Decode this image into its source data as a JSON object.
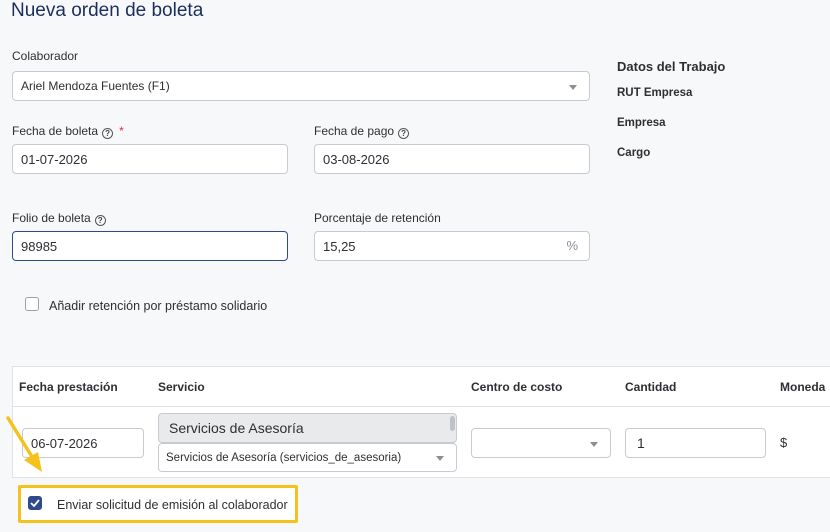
{
  "page": {
    "title": "Nueva orden de boleta"
  },
  "form": {
    "colaborador": {
      "label": "Colaborador",
      "value": "Ariel Mendoza Fuentes (F1)"
    },
    "fecha_boleta": {
      "label": "Fecha de boleta",
      "required_mark": "*",
      "value": "01-07-2026"
    },
    "fecha_pago": {
      "label": "Fecha de pago",
      "value": "03-08-2026"
    },
    "folio": {
      "label": "Folio de boleta",
      "value": "98985"
    },
    "retencion": {
      "label": "Porcentaje de retención",
      "value": "15,25",
      "suffix": "%"
    },
    "prestamo_checkbox": {
      "label": "Añadir retención por préstamo solidario",
      "checked": false
    },
    "help_glyph": "?"
  },
  "side": {
    "heading": "Datos del Trabajo",
    "rut": "RUT Empresa",
    "empresa": "Empresa",
    "cargo": "Cargo"
  },
  "table": {
    "headers": [
      "Fecha prestación",
      "Servicio",
      "Centro de costo",
      "Cantidad",
      "Moneda"
    ],
    "row": {
      "fecha": "06-07-2026",
      "servicio_dropdown_option": "Servicios de Asesoría",
      "servicio_value": "Servicios de Asesoría (servicios_de_asesoria)",
      "centro_costo": "",
      "cantidad": "1",
      "moneda": "$"
    }
  },
  "send_checkbox": {
    "label": "Enviar solicitud de emisión al colaborador",
    "checked": true
  },
  "colors": {
    "accent": "#2f4a8a",
    "highlight": "#f5c21b",
    "title": "#1c2e5c"
  }
}
